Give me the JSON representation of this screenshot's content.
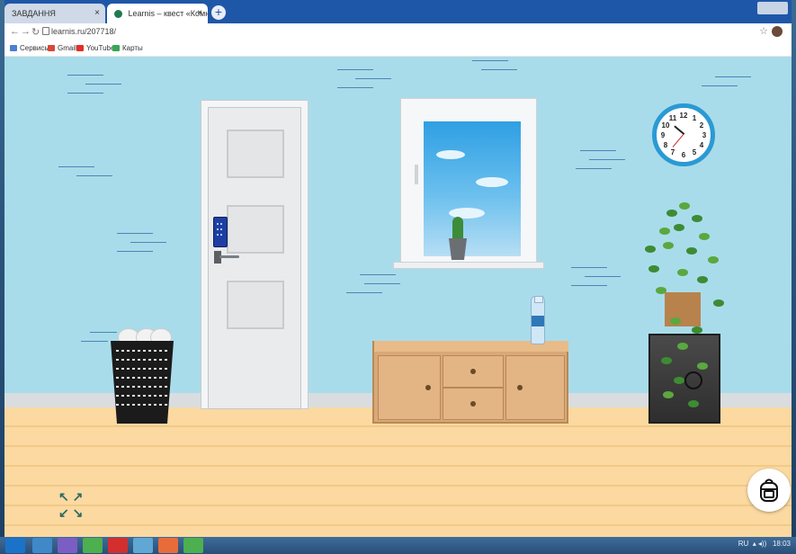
{
  "browser": {
    "tabs": [
      {
        "label": "ЗАВДАННЯ",
        "active": false
      },
      {
        "label": "Learnis – квест «Комната с окно",
        "active": true
      }
    ],
    "new_tab_symbol": "+",
    "close_symbol": "×",
    "url": "learnis.ru/207718/",
    "bookmarks": [
      {
        "label": "Сервисы",
        "icon": "apps-icon"
      },
      {
        "label": "Gmail",
        "icon": "gmail-icon"
      },
      {
        "label": "YouTube",
        "icon": "youtube-icon"
      },
      {
        "label": "Карты",
        "icon": "maps-icon"
      }
    ]
  },
  "scene": {
    "clock_numbers": [
      "12",
      "1",
      "2",
      "3",
      "4",
      "5",
      "6",
      "7",
      "8",
      "9",
      "10",
      "11"
    ],
    "expand_glyphs": {
      "tl": "↖",
      "tr": "↗",
      "bl": "↙",
      "br": "↘"
    }
  },
  "taskbar": {
    "language": "RU",
    "time": "18:03"
  },
  "colors": {
    "wall": "#a9dcea",
    "floor": "#fbd9a0",
    "clock_rim": "#2a9ad4",
    "cabinet": "#d9a878",
    "tabbar": "#1f57a8"
  }
}
